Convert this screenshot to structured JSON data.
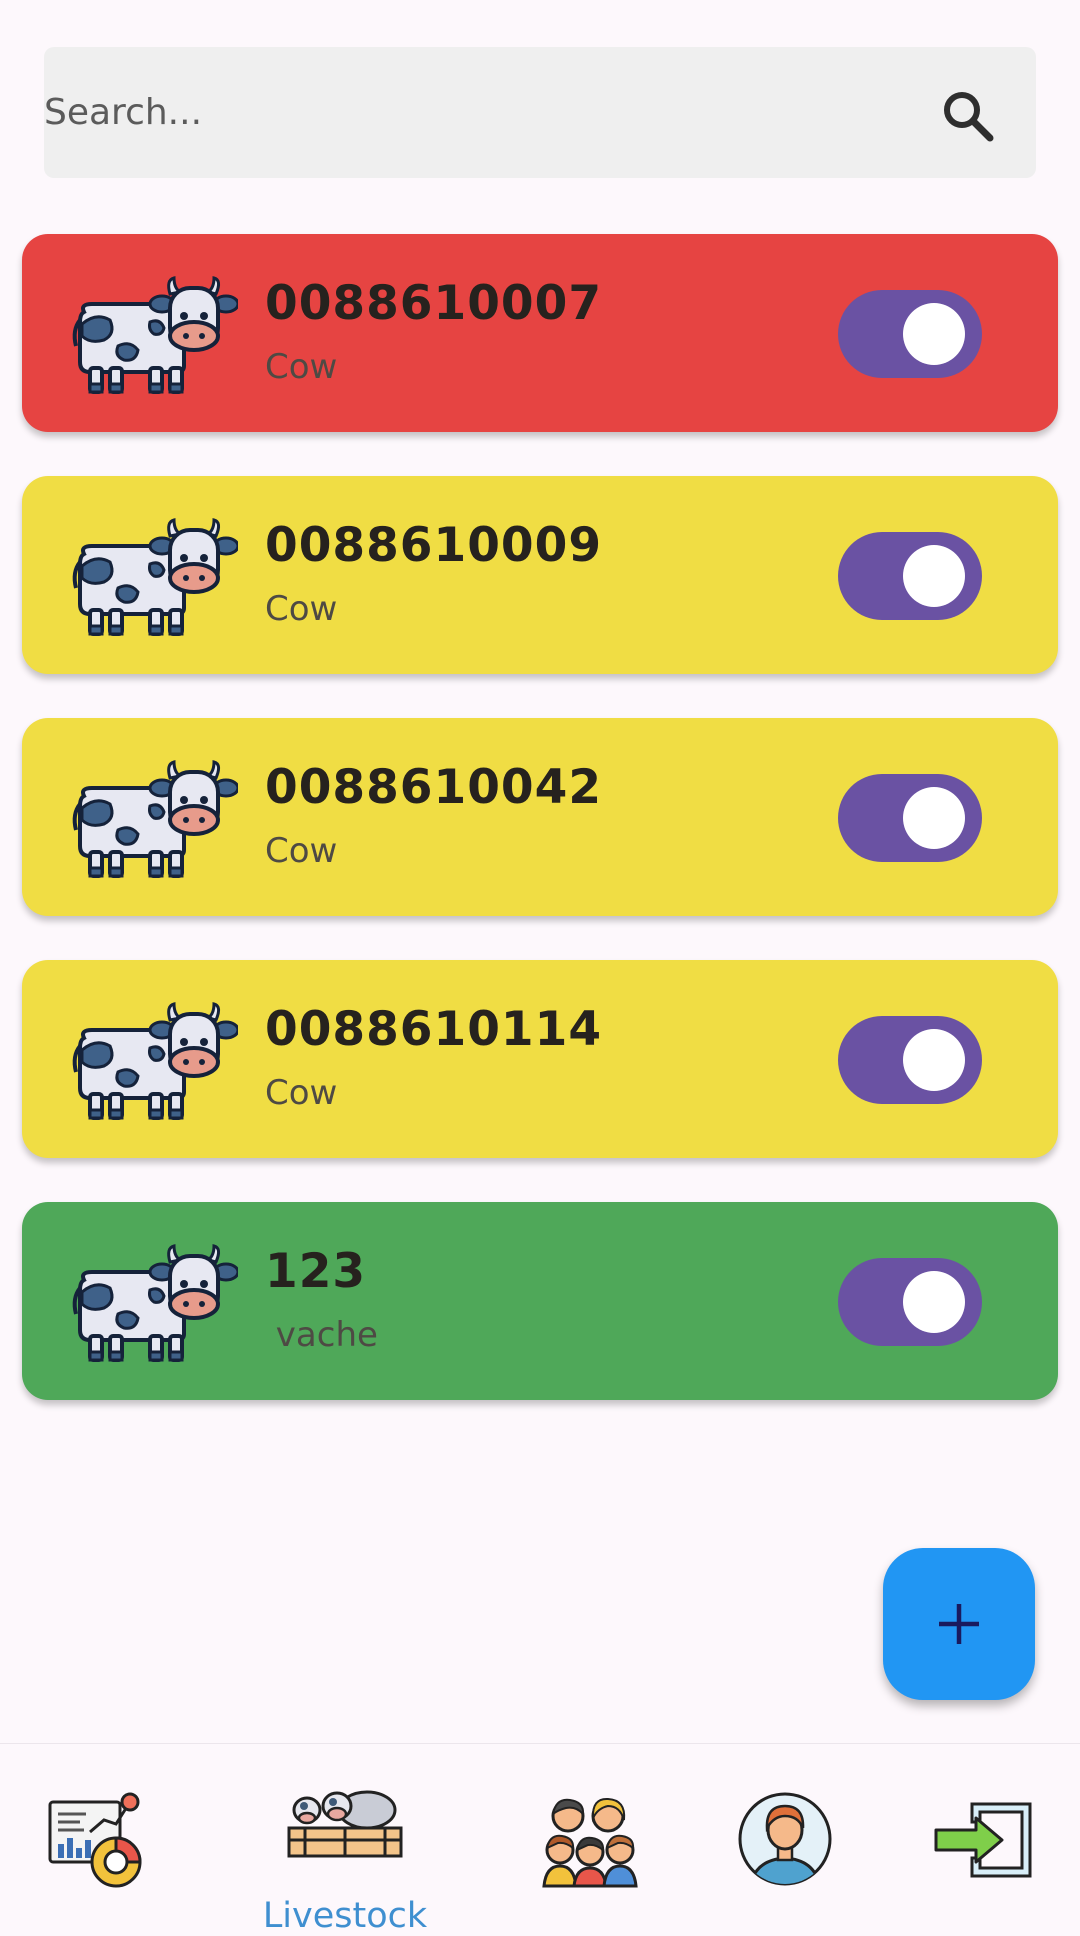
{
  "search": {
    "placeholder": "Search..."
  },
  "livestock": [
    {
      "id": "0088610007",
      "type": "Cow",
      "color": "#e64442",
      "toggle_on": true
    },
    {
      "id": "0088610009",
      "type": "Cow",
      "color": "#f0dd44",
      "toggle_on": true
    },
    {
      "id": "0088610042",
      "type": "Cow",
      "color": "#f0dd44",
      "toggle_on": true
    },
    {
      "id": "0088610114",
      "type": "Cow",
      "color": "#f0dd44",
      "toggle_on": true
    },
    {
      "id": "123",
      "type": " vache",
      "color": "#4fa859",
      "toggle_on": true
    }
  ],
  "fab": {
    "icon": "plus-icon"
  },
  "nav": {
    "items": [
      {
        "name": "dashboard",
        "icon": "analytics-chart-icon",
        "label": ""
      },
      {
        "name": "livestock",
        "icon": "cows-pen-icon",
        "label": "Livestock",
        "active": true
      },
      {
        "name": "people",
        "icon": "people-group-icon",
        "label": ""
      },
      {
        "name": "profile",
        "icon": "user-avatar-icon",
        "label": ""
      },
      {
        "name": "logout",
        "icon": "logout-arrow-icon",
        "label": ""
      }
    ]
  },
  "colors": {
    "accent": "#2196f3",
    "toggle": "#6a52a3",
    "nav_active": "#3f8fd0",
    "alert_red": "#e64442",
    "warning_yellow": "#f0dd44",
    "ok_green": "#4fa859"
  }
}
